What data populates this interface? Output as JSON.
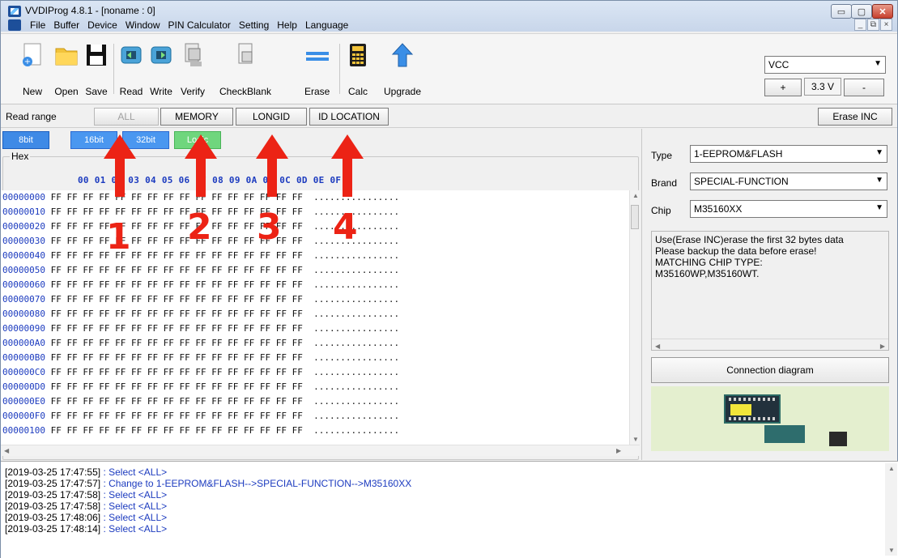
{
  "window": {
    "title": "VVDIProg 4.8.1 - [noname : 0]",
    "minimize_glyph": "▭",
    "maximize_glyph": "▢",
    "close_glyph": "✕"
  },
  "menu": {
    "items": [
      "File",
      "Buffer",
      "Device",
      "Window",
      "PIN Calculator",
      "Setting",
      "Help",
      "Language"
    ],
    "mdi": [
      "_",
      "⧉",
      "×"
    ]
  },
  "toolbar": {
    "buttons": [
      {
        "label": "New",
        "icon": "new-file-icon"
      },
      {
        "label": "Open",
        "icon": "folder-icon"
      },
      {
        "label": "Save",
        "icon": "floppy-icon"
      },
      {
        "label": "Read",
        "icon": "chip-read-icon"
      },
      {
        "label": "Write",
        "icon": "chip-write-icon"
      },
      {
        "label": "Verify",
        "icon": "verify-icon"
      },
      {
        "label": "CheckBlank",
        "icon": "checkblank-icon"
      },
      {
        "label": "Erase",
        "icon": "erase-icon"
      },
      {
        "label": "Calc",
        "icon": "calculator-icon"
      },
      {
        "label": "Upgrade",
        "icon": "upgrade-arrow-icon"
      }
    ],
    "vcc": {
      "value": "VCC"
    },
    "voltage": {
      "value": "3.3 V",
      "plus": "+",
      "minus": "-"
    }
  },
  "read_range": {
    "label": "Read range",
    "buttons": [
      "ALL",
      "MEMORY",
      "LONGID",
      "ID LOCATION"
    ],
    "erase_inc": "Erase INC"
  },
  "hex": {
    "modes": [
      "8bit",
      "16bit",
      "32bit",
      "Logic"
    ],
    "group_label": "Hex",
    "column_header": "00 01 02 03 04 05 06 07 08 09 0A 0B 0C 0D 0E 0F",
    "data_line": "FF FF FF FF FF FF FF FF FF FF FF FF FF FF FF FF",
    "ascii_line": "................",
    "addresses": [
      "00000000",
      "00000010",
      "00000020",
      "00000030",
      "00000040",
      "00000050",
      "00000060",
      "00000070",
      "00000080",
      "00000090",
      "000000A0",
      "000000B0",
      "000000C0",
      "000000D0",
      "000000E0",
      "000000F0",
      "00000100"
    ]
  },
  "device": {
    "type_label": "Type",
    "type_value": "1-EEPROM&FLASH",
    "brand_label": "Brand",
    "brand_value": "SPECIAL-FUNCTION",
    "chip_label": "Chip",
    "chip_value": "M35160XX",
    "info_lines": [
      "Use(Erase INC)erase the first 32 bytes data",
      "Please backup the data before erase!",
      "MATCHING CHIP TYPE:",
      "M35160WP,M35160WT."
    ],
    "connection_button": "Connection diagram"
  },
  "log": [
    {
      "time": "[2019-03-25 17:47:55]",
      "msg": " : Select <ALL>"
    },
    {
      "time": "[2019-03-25 17:47:57]",
      "msg": " : Change to 1-EEPROM&FLASH-->SPECIAL-FUNCTION-->M35160XX"
    },
    {
      "time": "[2019-03-25 17:47:58]",
      "msg": " : Select <ALL>"
    },
    {
      "time": "[2019-03-25 17:47:58]",
      "msg": " : Select <ALL>"
    },
    {
      "time": "[2019-03-25 17:48:06]",
      "msg": " : Select <ALL>"
    },
    {
      "time": "[2019-03-25 17:48:14]",
      "msg": " : Select <ALL>"
    }
  ],
  "annotations": [
    "1",
    "2",
    "3",
    "4"
  ],
  "colors": {
    "accent_blue": "#1c3bbf",
    "annotation_red": "#ec2315",
    "logic_green": "#6fd67d"
  }
}
